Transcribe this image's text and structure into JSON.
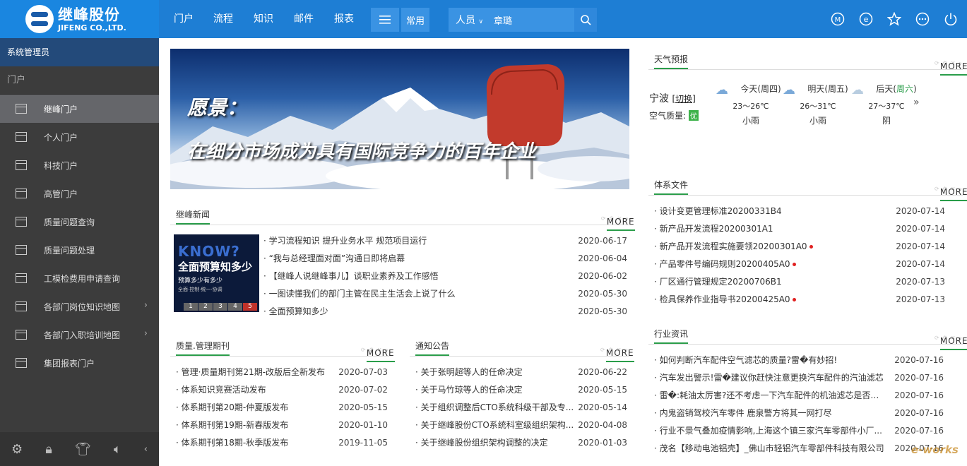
{
  "logo": {
    "cn": "继峰股份",
    "en": "JIFENG CO.,LTD."
  },
  "topnav": {
    "items": [
      "门户",
      "流程",
      "知识",
      "邮件",
      "报表"
    ],
    "common_label": "常用",
    "search_category": "人员",
    "search_value": "章璐"
  },
  "sidebar": {
    "user": "系统管理员",
    "group": "门户",
    "items": [
      {
        "label": "继峰门户"
      },
      {
        "label": "个人门户"
      },
      {
        "label": "科技门户"
      },
      {
        "label": "高管门户"
      },
      {
        "label": "质量问题查询"
      },
      {
        "label": "质量问题处理"
      },
      {
        "label": "工模检费用申请查询"
      },
      {
        "label": "各部门岗位知识地图"
      },
      {
        "label": "各部门入职培训地图"
      },
      {
        "label": "集团报表门户"
      }
    ]
  },
  "banner": {
    "line1": "愿景：",
    "line2": "在细分市场成为具有国际竞争力的百年企业"
  },
  "panel_tools": "MORE",
  "news": {
    "title": "继峰新闻",
    "image": {
      "title": "KNOW?",
      "subtitle": "全面预算知多少",
      "line1": "预算多少有多少",
      "line2": "全面·控制·统一·协调",
      "pages": [
        "1",
        "2",
        "3",
        "4",
        "5"
      ]
    },
    "rows": [
      {
        "text": "学习流程知识 提升业务水平 规范项目运行",
        "date": "2020-06-17"
      },
      {
        "text": "“我与总经理面对面”沟通日即将启幕",
        "date": "2020-06-04"
      },
      {
        "text": "【继峰人说继峰事儿】谈职业素养及工作感悟",
        "date": "2020-06-02"
      },
      {
        "text": "一图读懂我们的部门主管在民主生活会上说了什么",
        "date": "2020-05-30"
      },
      {
        "text": "全面预算知多少",
        "date": "2020-05-30"
      }
    ]
  },
  "quality": {
    "title": "质量.管理期刊",
    "rows": [
      {
        "text": "管理·质量期刊第21期-改版后全新发布",
        "date": "2020-07-03"
      },
      {
        "text": "体系知识竞赛活动发布",
        "date": "2020-07-02"
      },
      {
        "text": "体系期刊第20期-仲夏版发布",
        "date": "2020-05-15"
      },
      {
        "text": "体系期刊第19期-新春版发布",
        "date": "2020-01-10"
      },
      {
        "text": "体系期刊第18期-秋季版发布",
        "date": "2019-11-05"
      }
    ]
  },
  "notice": {
    "title": "通知公告",
    "rows": [
      {
        "text": "关于张明超等人的任命决定",
        "date": "2020-06-22"
      },
      {
        "text": "关于马竹琼等人的任命决定",
        "date": "2020-05-15"
      },
      {
        "text": "关于组织调整后CTO系统科级干部及专...",
        "date": "2020-05-14"
      },
      {
        "text": "关于继峰股份CTO系统科室级组织架构...",
        "date": "2020-04-08"
      },
      {
        "text": "关于继峰股份组织架构调整的决定",
        "date": "2020-01-03"
      }
    ]
  },
  "weather": {
    "title": "天气预报",
    "city": "宁波",
    "switch": "[切换]",
    "air_label": "空气质量:",
    "air_value": "优",
    "days": [
      {
        "label": "今天(周四)",
        "temp": "23～26℃",
        "desc": "小雨"
      },
      {
        "label": "明天(周五)",
        "temp": "26～31℃",
        "desc": "小雨"
      },
      {
        "label": "后天(",
        "label_hl": "周六",
        "label_end": ")",
        "temp": "27～37℃",
        "desc": "阴"
      }
    ],
    "more": "»"
  },
  "system_files": {
    "title": "体系文件",
    "rows": [
      {
        "text": "设计变更管理标准20200331B4",
        "date": "2020-07-14",
        "new": false
      },
      {
        "text": "新产品开发流程20200301A1",
        "date": "2020-07-14",
        "new": false
      },
      {
        "text": "新产品开发流程实施要领20200301A0",
        "date": "2020-07-14",
        "new": true
      },
      {
        "text": "产品零件号编码规则20200405A0",
        "date": "2020-07-14",
        "new": true
      },
      {
        "text": "厂区通行管理规定20200706B1",
        "date": "2020-07-13",
        "new": false
      },
      {
        "text": "检具保养作业指导书20200425A0",
        "date": "2020-07-13",
        "new": true
      }
    ]
  },
  "industry": {
    "title": "行业资讯",
    "rows": [
      {
        "text": "如何判断汽车配件空气滤芯的质量?雷�有妙招!",
        "date": "2020-07-16"
      },
      {
        "text": "汽车发出警示!雷�建议你赶快注意更换汽车配件的汽油滤芯",
        "date": "2020-07-16"
      },
      {
        "text": "雷�:耗油太厉害?还不考虑一下汽车配件的机油滤芯是否有...",
        "date": "2020-07-16"
      },
      {
        "text": "内鬼盗销驾校汽车零件 鹿泉警方将其一网打尽",
        "date": "2020-07-16"
      },
      {
        "text": "行业不景气叠加疫情影响,上海这个镇三家汽车零部件小厂...",
        "date": "2020-07-16"
      },
      {
        "text": "茂名【移动电池铝壳】_佛山市轻铝汽车零部件科技有限公司",
        "date": "2020-07-16"
      }
    ]
  },
  "watermark": "e-works"
}
